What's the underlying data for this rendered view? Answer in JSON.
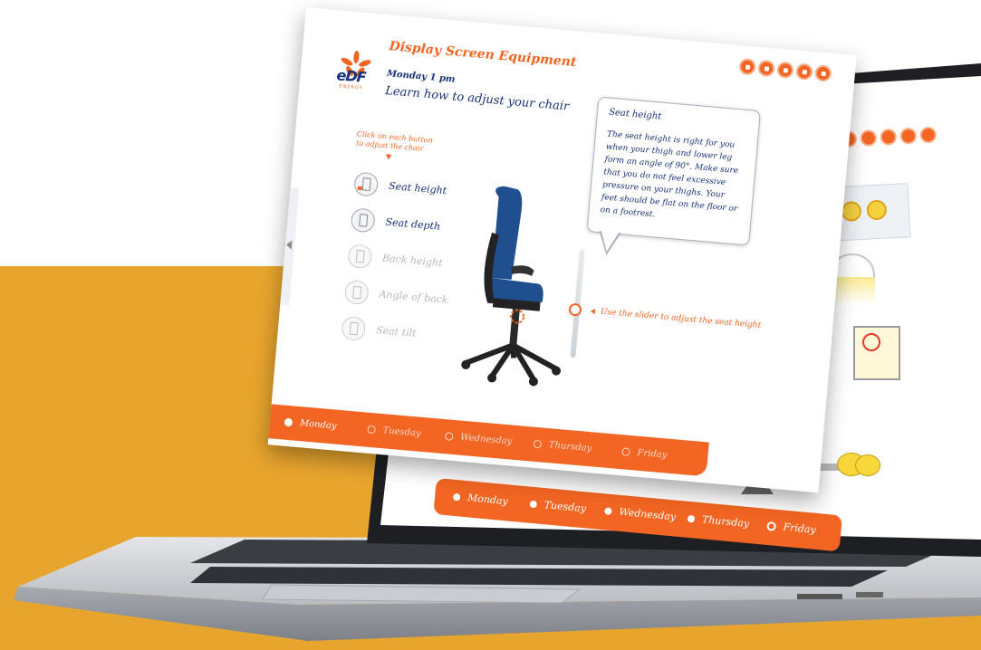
{
  "app": {
    "title": "Display Screen Equipment",
    "subtitle": "Monday 1 pm",
    "lesson": "Learn how to adjust your chair",
    "logo_text": "eDF",
    "logo_subtext": "ENERGY"
  },
  "toolbar": {
    "buttons": [
      "info-icon",
      "help-icon",
      "notes-icon",
      "print-icon",
      "sound-icon"
    ]
  },
  "instructions": "Click on each button to adjust the chair",
  "adjustments": [
    {
      "label": "Seat height",
      "state": "active"
    },
    {
      "label": "Seat depth",
      "state": "enabled"
    },
    {
      "label": "Back height",
      "state": "disabled"
    },
    {
      "label": "Angle of back",
      "state": "disabled"
    },
    {
      "label": "Seat tilt",
      "state": "disabled"
    }
  ],
  "info_bubble": {
    "title": "Seat height",
    "text": "The seat height is right for you when your thigh and lower leg form an angle of 90°. Make sure that you do not feel excessive pressure on your thighs. Your feet should be flat on the floor or on a footrest."
  },
  "slider": {
    "hint": "Use the slider to adjust the seat height"
  },
  "front_days": [
    "Monday",
    "Tuesday",
    "Wednesday",
    "Thursday",
    "Friday"
  ],
  "front_active_day": "Monday",
  "back_days": [
    "Monday",
    "Tuesday",
    "Wednesday",
    "Thursday",
    "Friday"
  ],
  "back_active_day": "Friday",
  "colors": {
    "accent": "#f26522",
    "brand_blue": "#15327a",
    "background_band": "#e8a52e"
  }
}
